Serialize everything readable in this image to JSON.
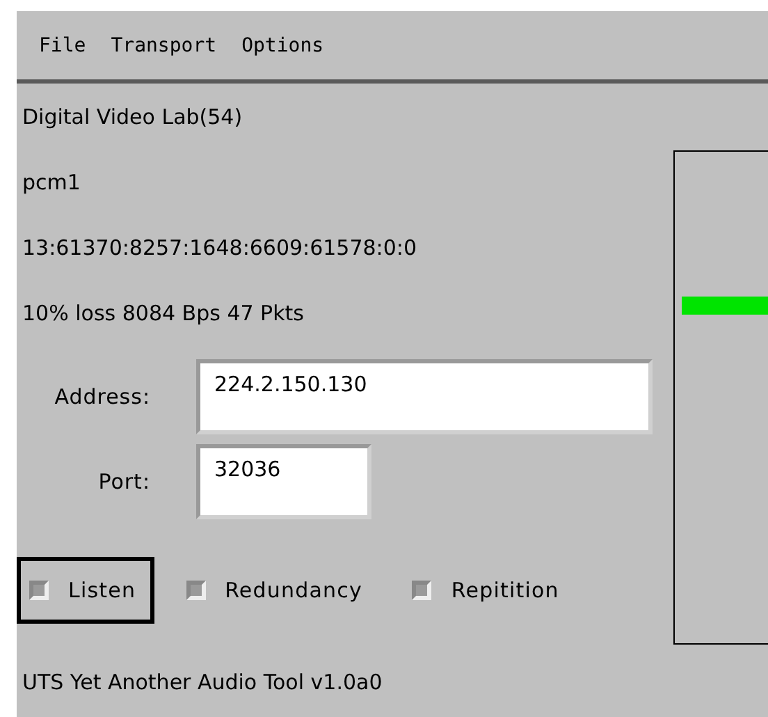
{
  "menu": [
    {
      "label": "File"
    },
    {
      "label": "Transport"
    },
    {
      "label": "Options"
    }
  ],
  "info_lines": [
    "Digital Video Lab(54)",
    "pcm1",
    "13:61370:8257:1648:6609:61578:0:0",
    "10% loss 8084 Bps 47 Pkts"
  ],
  "fields": [
    {
      "label": "Address:",
      "value": "224.2.150.130",
      "wide": true
    },
    {
      "label": "Port:",
      "value": "32036",
      "wide": false
    }
  ],
  "options": [
    {
      "label": "Listen",
      "checked": false,
      "focused": true
    },
    {
      "label": "Redundancy",
      "checked": false,
      "focused": false
    },
    {
      "label": "Repitition",
      "checked": false,
      "focused": false
    }
  ],
  "status": "UTS Yet Another Audio Tool v1.0a0"
}
